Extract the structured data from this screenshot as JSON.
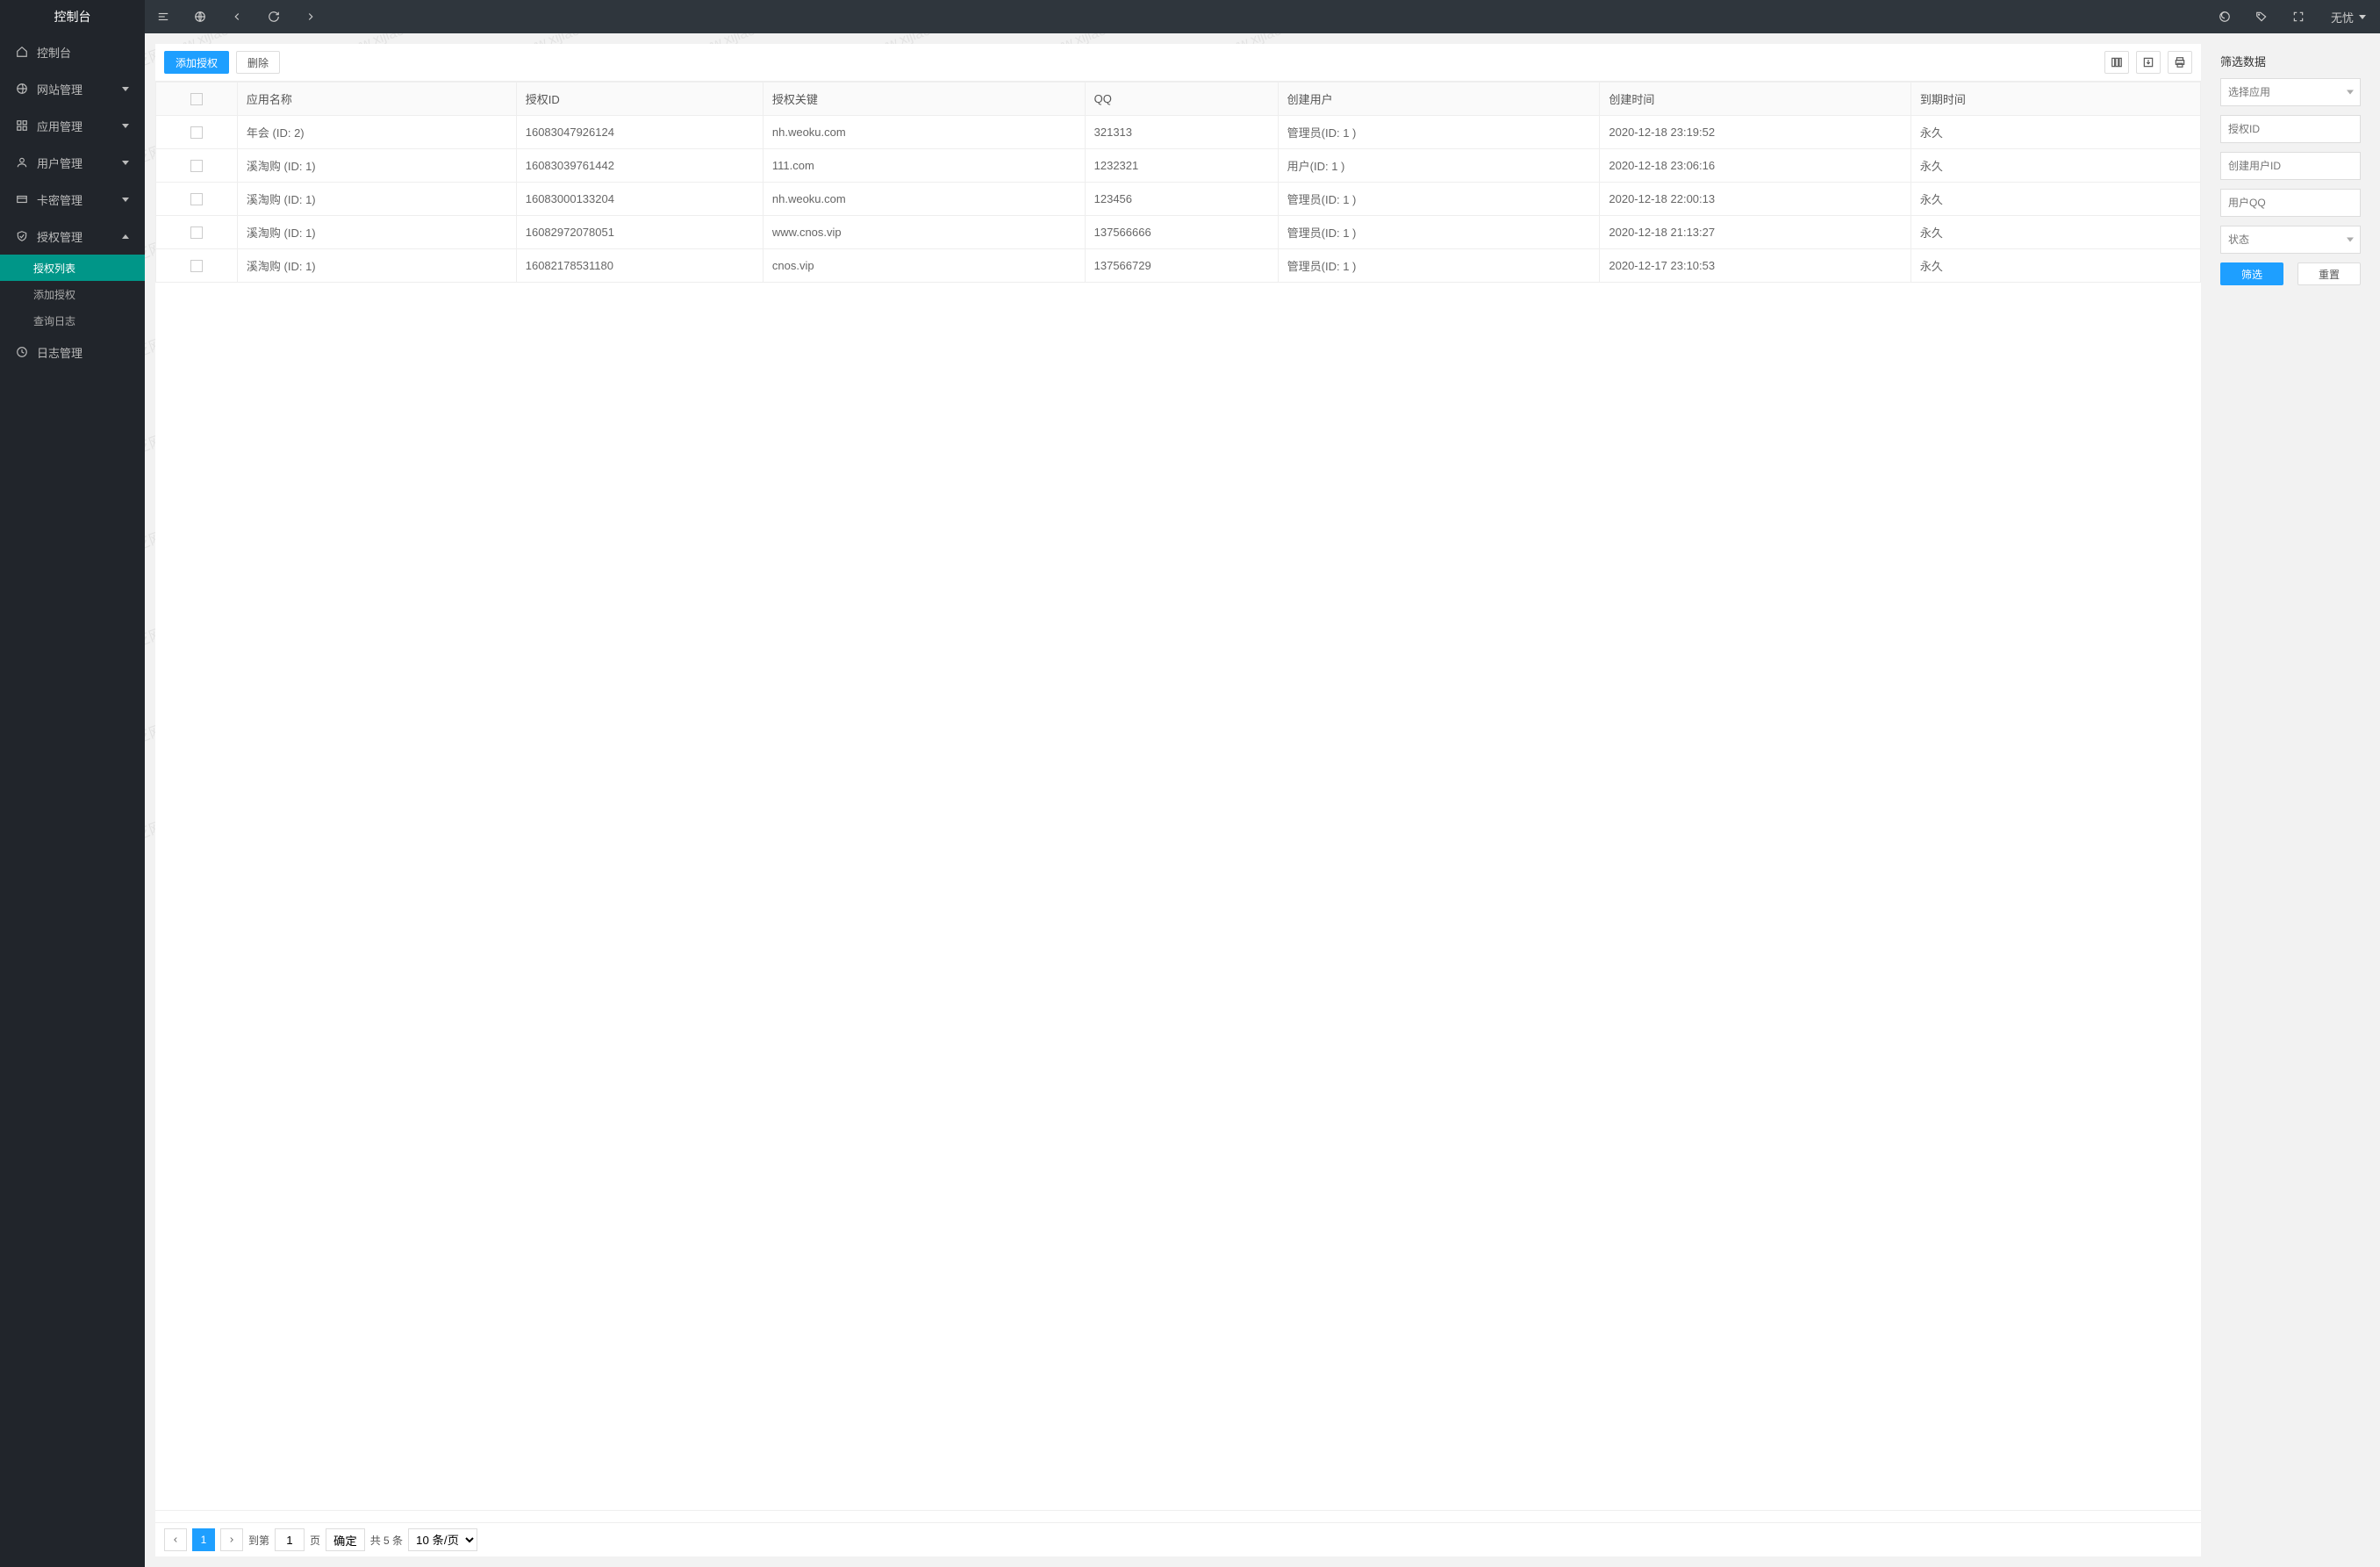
{
  "sidebar": {
    "logo": "控制台",
    "items": [
      {
        "icon": "home",
        "label": "控制台",
        "expand": null
      },
      {
        "icon": "globe",
        "label": "网站管理",
        "expand": "down"
      },
      {
        "icon": "grid",
        "label": "应用管理",
        "expand": "down"
      },
      {
        "icon": "user",
        "label": "用户管理",
        "expand": "down"
      },
      {
        "icon": "card",
        "label": "卡密管理",
        "expand": "down"
      },
      {
        "icon": "shield",
        "label": "授权管理",
        "expand": "up",
        "children": [
          {
            "label": "授权列表",
            "active": true
          },
          {
            "label": "添加授权",
            "active": false
          },
          {
            "label": "查询日志",
            "active": false
          }
        ]
      },
      {
        "icon": "clock",
        "label": "日志管理",
        "expand": null
      }
    ]
  },
  "topbar": {
    "user": "无忧"
  },
  "toolbar": {
    "add": "添加授权",
    "delete": "删除"
  },
  "table": {
    "headers": [
      "应用名称",
      "授权ID",
      "授权关键",
      "QQ",
      "创建用户",
      "创建时间",
      "到期时间"
    ],
    "rows": [
      {
        "app": "年会 (ID: 2)",
        "authid": "16083047926124",
        "key": "nh.weoku.com",
        "qq": "321313",
        "creator": "管理员(ID: 1 )",
        "created": "2020-12-18 23:19:52",
        "expire": "永久"
      },
      {
        "app": "溪淘购 (ID: 1)",
        "authid": "16083039761442",
        "key": "111.com",
        "qq": "1232321",
        "creator": "用户(ID: 1 )",
        "created": "2020-12-18 23:06:16",
        "expire": "永久"
      },
      {
        "app": "溪淘购 (ID: 1)",
        "authid": "16083000133204",
        "key": "nh.weoku.com",
        "qq": "123456",
        "creator": "管理员(ID: 1 )",
        "created": "2020-12-18 22:00:13",
        "expire": "永久"
      },
      {
        "app": "溪淘购 (ID: 1)",
        "authid": "16082972078051",
        "key": "www.cnos.vip",
        "qq": "137566666",
        "creator": "管理员(ID: 1 )",
        "created": "2020-12-18 21:13:27",
        "expire": "永久"
      },
      {
        "app": "溪淘购 (ID: 1)",
        "authid": "16082178531180",
        "key": "cnos.vip",
        "qq": "137566729",
        "creator": "管理员(ID: 1 )",
        "created": "2020-12-17 23:10:53",
        "expire": "永久"
      }
    ]
  },
  "pager": {
    "page": "1",
    "goto_label": "到第",
    "page_suffix": "页",
    "confirm": "确定",
    "total": "共 5 条",
    "per_page": "10 条/页"
  },
  "filter": {
    "title": "筛选数据",
    "select_app": "选择应用",
    "auth_id": "授权ID",
    "creator_id": "创建用户ID",
    "user_qq": "用户QQ",
    "status": "状态",
    "filter_btn": "筛选",
    "reset_btn": "重置"
  },
  "watermark": "迅芝网 www.xijiao.cn"
}
